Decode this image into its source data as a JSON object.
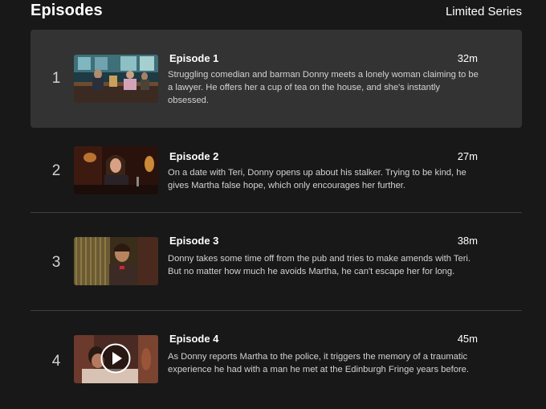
{
  "header": {
    "title": "Episodes",
    "badge": "Limited Series"
  },
  "episodes": [
    {
      "number": "1",
      "title": "Episode 1",
      "duration": "32m",
      "description": "Struggling comedian and barman Donny meets a lonely woman claiming to be a lawyer. He offers her a cup of tea on the house, and she's instantly obsessed."
    },
    {
      "number": "2",
      "title": "Episode 2",
      "duration": "27m",
      "description": "On a date with Teri, Donny opens up about his stalker. Trying to be kind, he gives Martha false hope, which only encourages her further."
    },
    {
      "number": "3",
      "title": "Episode 3",
      "duration": "38m",
      "description": "Donny takes some time off from the pub and tries to make amends with Teri. But no matter how much he avoids Martha, he can't escape her for long."
    },
    {
      "number": "4",
      "title": "Episode 4",
      "duration": "45m",
      "description": "As Donny reports Martha to the police, it triggers the memory of a traumatic experience he had with a man he met at the Edinburgh Fringe years before."
    }
  ],
  "icons": {
    "play": "play-icon"
  },
  "colors": {
    "background": "#181818",
    "active_row": "#333333",
    "divider": "#404040",
    "text_primary": "#ffffff",
    "text_secondary": "#d2d2d2"
  }
}
